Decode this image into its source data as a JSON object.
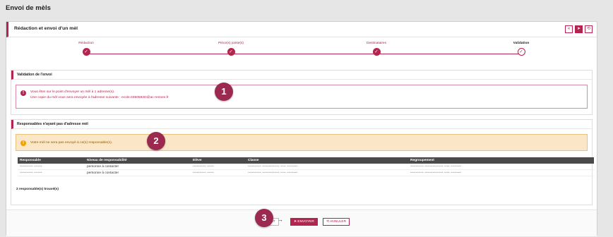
{
  "page": {
    "title": "Envoi de mèls"
  },
  "window": {
    "title": "Rédaction et envoi d'un mèl"
  },
  "header_buttons": [
    "«",
    "➤",
    "⟲"
  ],
  "steps": [
    {
      "label": "Rédaction",
      "mark": "✓"
    },
    {
      "label": "Pièce(s) jointe(s)",
      "mark": "✓"
    },
    {
      "label": "Destinataires",
      "mark": "✓"
    },
    {
      "label": "Validation",
      "mark": "✓"
    }
  ],
  "validation_panel": {
    "title": "Validation de l'envoi",
    "line1": "Vous êtes sur le point d'envoyer un mèl à 1 adresse(s).",
    "line2": "Une copie du mèl vous sera envoyée à l'adresse suivante : ecole.0350592D@ac-rennes.fr"
  },
  "responsables_panel": {
    "title": "Responsables n'ayant pas d'adresse mèl",
    "warning": "Votre mèl ne sera pas envoyé à ce(s) responsable(s).",
    "columns": [
      "Responsable",
      "Niveau de responsabilité",
      "Elève",
      "Classe",
      "Regroupement"
    ],
    "rows": [
      [
        "•••••••••• ••••••",
        "personne à contacter",
        "•••••••••• •••••",
        "•••••••••• ••••••••••••• •••• ••••••••",
        "•••••••••• •••••••••••••• •••• ••••••••"
      ],
      [
        "•••••••••• ••••••",
        "personne à contacter",
        "•••••••••• •••••",
        "•••••••••• ••••••••••••• •••• ••••••••",
        "•••••••••• •••••••••••••• •••• ••••••••"
      ]
    ],
    "count": "2 responsable(s) trouvé(s)"
  },
  "footer": {
    "prev_label": "ENT",
    "send_label": "ENVOYER",
    "send_icon": "➤",
    "cancel_label": "ANNULER",
    "cancel_icon": "⟲"
  },
  "badges": [
    "1",
    "2",
    "3"
  ],
  "colors": {
    "accent": "#b3244e",
    "badge": "#9b2950",
    "warning_bg": "#fbe7c8"
  }
}
